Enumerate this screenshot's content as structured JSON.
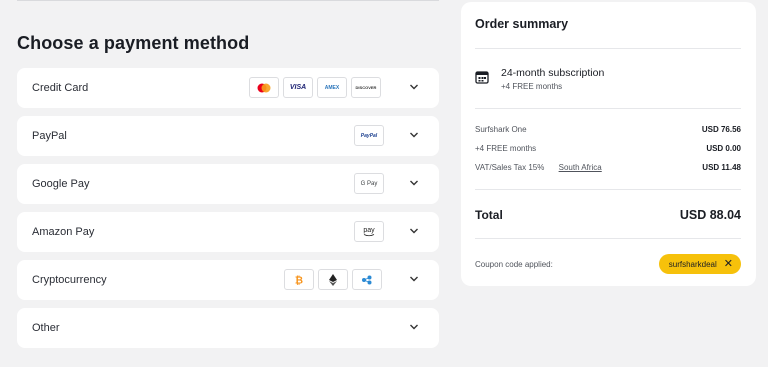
{
  "payment": {
    "heading": "Choose a payment method",
    "methods": [
      {
        "label": "Credit Card",
        "logos": [
          "mastercard",
          "VISA",
          "AMEX",
          "DISCOVER"
        ]
      },
      {
        "label": "PayPal",
        "logos": [
          "PayPal"
        ]
      },
      {
        "label": "Google Pay",
        "logos": [
          "G Pay"
        ]
      },
      {
        "label": "Amazon Pay",
        "logos": [
          "pay"
        ]
      },
      {
        "label": "Cryptocurrency",
        "logos": [
          "bitcoin",
          "ethereum",
          "ripple"
        ]
      },
      {
        "label": "Other",
        "logos": []
      }
    ]
  },
  "summary": {
    "title": "Order summary",
    "plan_name": "24-month subscription",
    "plan_sub": "+4 FREE months",
    "items": [
      {
        "label": "Surfshark One",
        "amount": "USD 76.56"
      },
      {
        "label": "+4 FREE months",
        "amount": "USD 0.00"
      },
      {
        "label": "VAT/Sales Tax 15%",
        "link": "South Africa",
        "amount": "USD 11.48"
      }
    ],
    "total_label": "Total",
    "total_amount": "USD 88.04",
    "coupon_label": "Coupon code applied:",
    "coupon_code": "surfsharkdeal",
    "coupon_remove": "✕"
  },
  "colors": {
    "accent": "#f6c10b",
    "page_bg": "#f2f2f3",
    "card_bg": "#ffffff"
  }
}
